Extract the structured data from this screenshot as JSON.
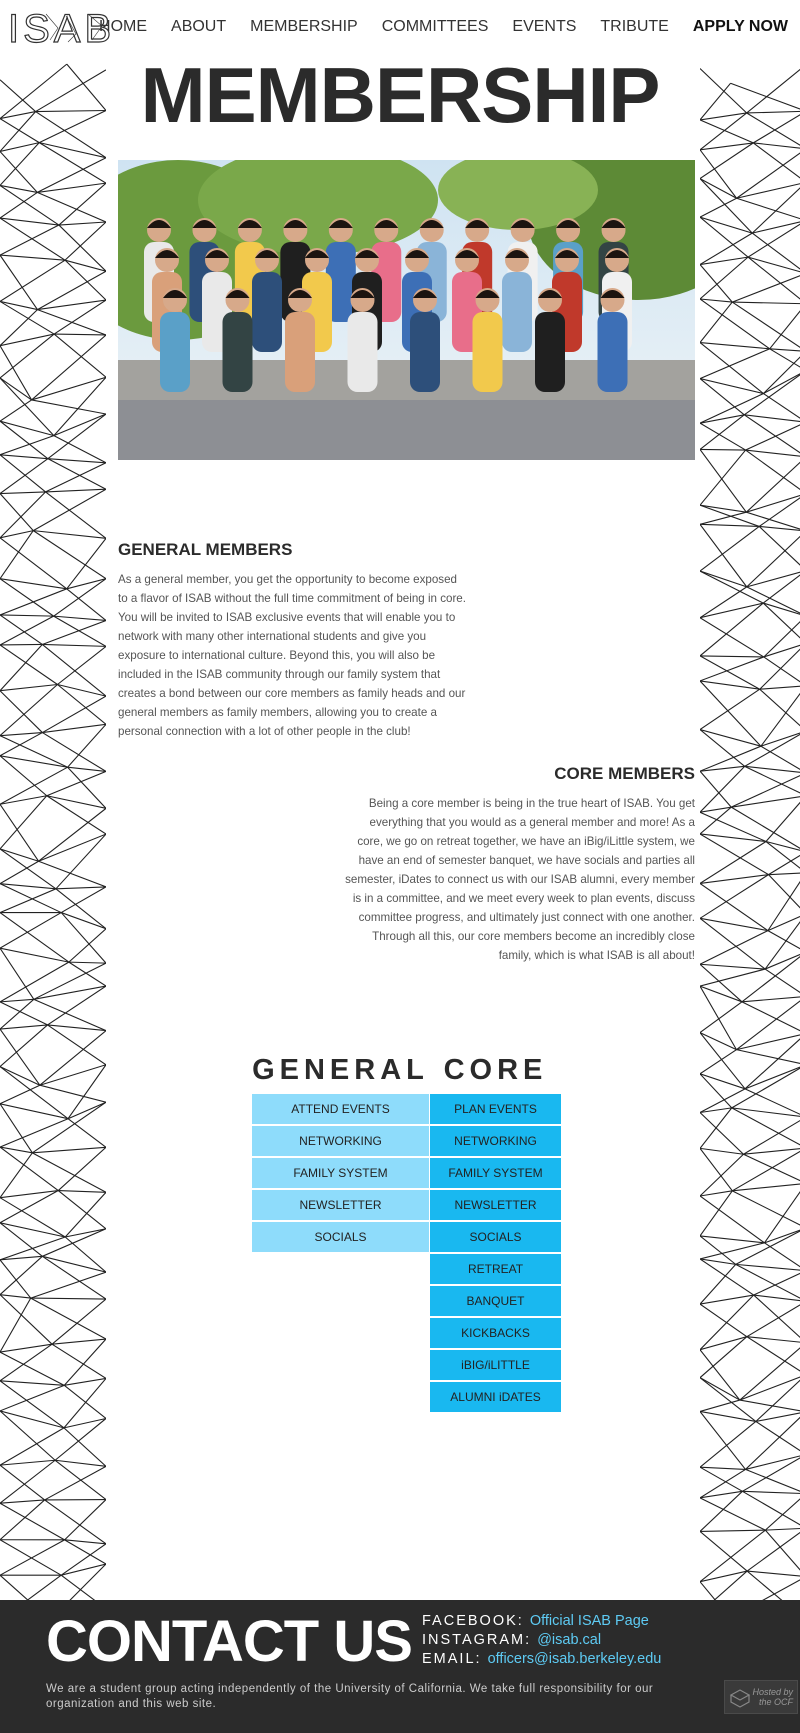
{
  "header": {
    "logo_text": "ISAB",
    "nav": [
      "HOME",
      "ABOUT",
      "MEMBERSHIP",
      "COMMITTEES",
      "EVENTS",
      "TRIBUTE",
      "APPLY NOW"
    ]
  },
  "page": {
    "title": "MEMBERSHIP"
  },
  "general_section": {
    "heading": "GENERAL MEMBERS",
    "body": "As a general member, you get the opportunity to become exposed to a flavor of ISAB without the full time commitment of being in core. You will be invited to ISAB exclusive events that will enable you to network with many other international students and give you exposure to international culture. Beyond this, you will also be included in the ISAB community through our family system that creates a bond between our core members as family heads and our general members as family members, allowing you to create a personal connection with a lot of other people in the club!"
  },
  "core_section": {
    "heading": "CORE MEMBERS",
    "body": "Being a core member is being in the true heart of ISAB. You get everything that you would as a general member and more! As a core, we go on retreat together, we have an iBig/iLittle system, we have an end of semester banquet, we have socials and parties all semester, iDates to connect us with our ISAB alumni, every member is in a committee, and we meet every week to plan events, discuss committee progress, and ultimately just connect with one another. Through all this, our core members become an incredibly close family, which is what ISAB is all about!"
  },
  "comparison": {
    "general_title": "GENERAL",
    "core_title": "CORE",
    "general_items": [
      "ATTEND EVENTS",
      "NETWORKING",
      "FAMILY SYSTEM",
      "NEWSLETTER",
      "SOCIALS"
    ],
    "core_items": [
      "PLAN EVENTS",
      "NETWORKING",
      "FAMILY SYSTEM",
      "NEWSLETTER",
      "SOCIALS",
      "RETREAT",
      "BANQUET",
      "KICKBACKS",
      "iBIG/iLITTLE",
      "ALUMNI iDATES"
    ],
    "colors": {
      "general": "#8edcfb",
      "core": "#19b8f0"
    }
  },
  "footer": {
    "title": "CONTACT US",
    "facebook_label": "FACEBOOK:",
    "facebook_link": "Official ISAB Page",
    "instagram_label": "INSTAGRAM:",
    "instagram_link": "@isab.cal",
    "email_label": "EMAIL:",
    "email_link": "officers@isab.berkeley.edu",
    "note": "We are a student group acting independently of the University of California. We take full responsibility for our organization and this web site.",
    "ocf_badge": "Hosted by the OCF"
  },
  "colors": {
    "footer_bg": "#2b2b2b",
    "link": "#5ecbf4",
    "title": "#2b2b2b"
  }
}
